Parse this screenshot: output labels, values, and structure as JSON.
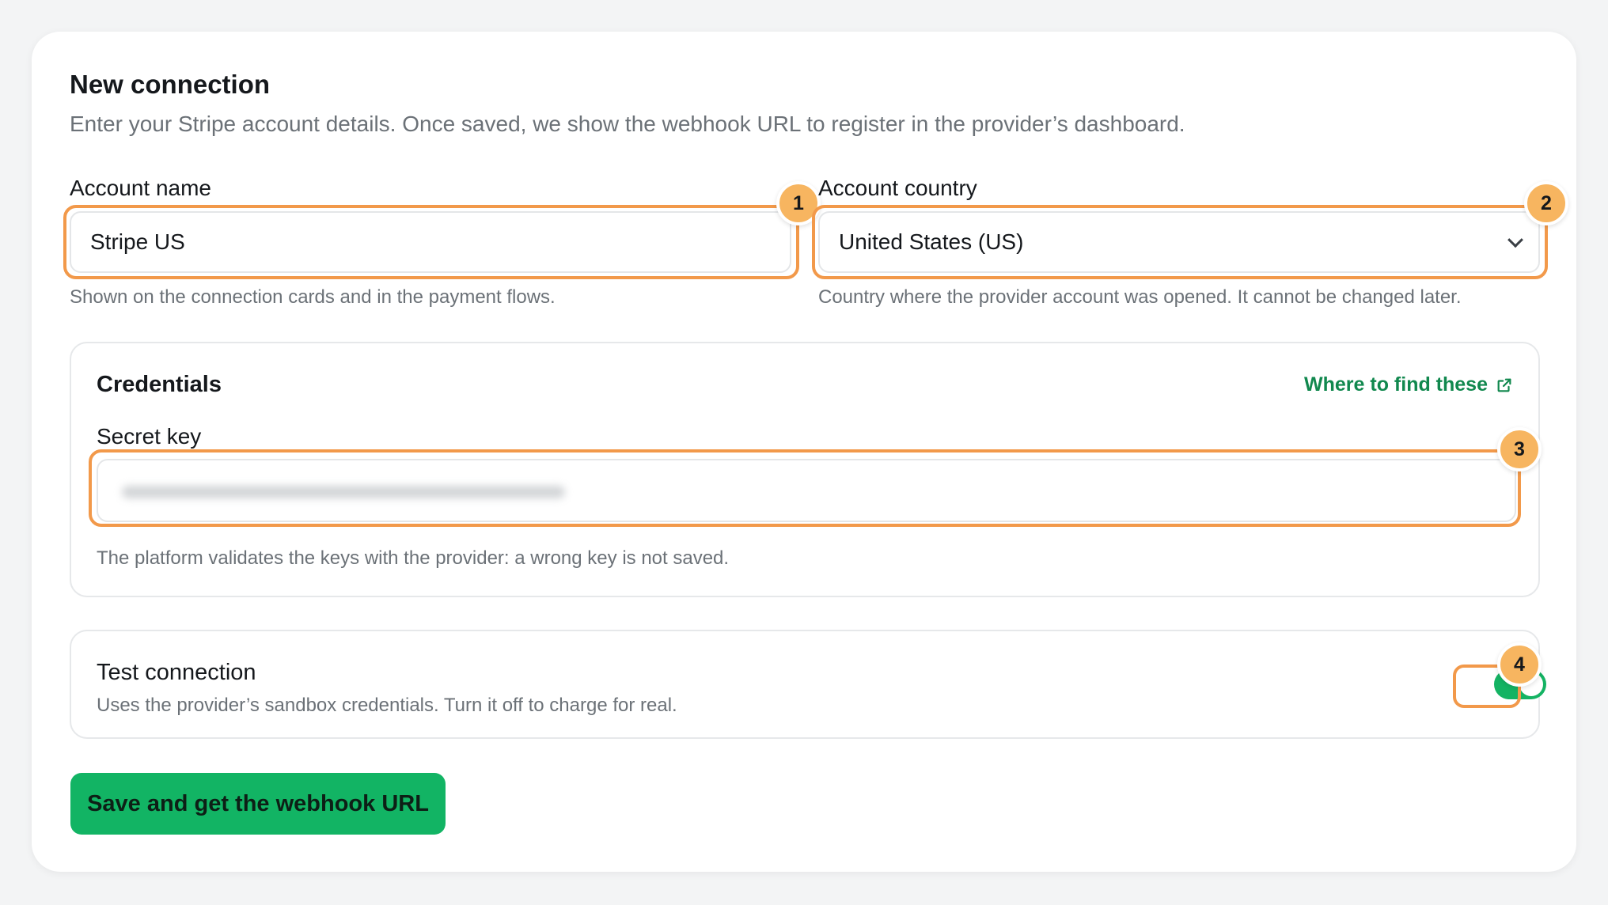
{
  "form": {
    "title": "New connection",
    "subtitle": "Enter your Stripe account details. Once saved, we show the webhook URL to register in the provider’s dashboard."
  },
  "account_name": {
    "label": "Account name",
    "value": "Stripe US",
    "hint": "Shown on the connection cards and in the payment flows."
  },
  "account_country": {
    "label": "Account country",
    "value": "United States (US)",
    "hint": "Country where the provider account was opened. It cannot be changed later."
  },
  "credentials": {
    "title": "Credentials",
    "help_link": "Where to find these",
    "secret_key_label": "Secret key",
    "hint": "The platform validates the keys with the provider: a wrong key is not saved."
  },
  "test_connection": {
    "title": "Test connection",
    "description": "Uses the provider’s sandbox credentials. Turn it off to charge for real.",
    "enabled": true
  },
  "actions": {
    "save_label": "Save and get the webhook URL"
  },
  "annotations": [
    "1",
    "2",
    "3",
    "4"
  ],
  "colors": {
    "accent_green": "#12b464",
    "link_green": "#11884e",
    "highlight_orange": "#f2994a",
    "badge_orange": "#f7b560"
  }
}
